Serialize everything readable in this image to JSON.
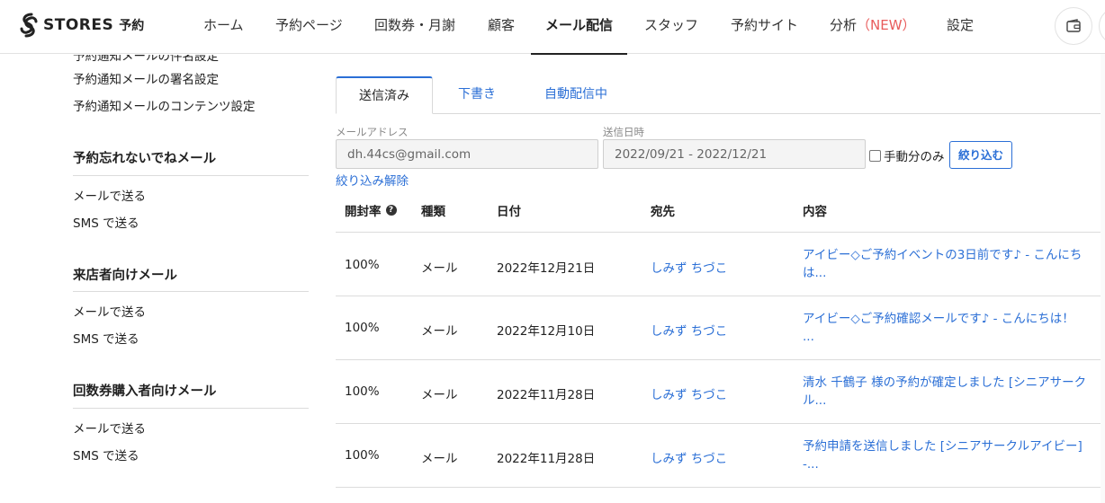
{
  "header": {
    "logo_text": "STORES",
    "logo_sub": "予約",
    "nav": [
      {
        "label": "ホーム"
      },
      {
        "label": "予約ページ"
      },
      {
        "label": "回数券・月謝"
      },
      {
        "label": "顧客"
      },
      {
        "label": "メール配信",
        "active": true
      },
      {
        "label": "スタッフ"
      },
      {
        "label": "予約サイト"
      },
      {
        "label": "分析",
        "badge": "（NEW）"
      },
      {
        "label": "設定"
      }
    ],
    "icons": [
      "wallet-icon"
    ]
  },
  "sidebar": {
    "links_top": [
      "予約通知メールの署名設定",
      "予約通知メールのコンテンツ設定"
    ],
    "sections": [
      {
        "title": "予約忘れないでねメール",
        "items": [
          "メールで送る",
          "SMS で送る"
        ]
      },
      {
        "title": "来店者向けメール",
        "items": [
          "メールで送る",
          "SMS で送る"
        ]
      },
      {
        "title": "回数券購入者向けメール",
        "items": [
          "メールで送る",
          "SMS で送る"
        ]
      }
    ]
  },
  "main": {
    "tabs": [
      {
        "label": "送信済み",
        "active": true
      },
      {
        "label": "下書き"
      },
      {
        "label": "自動配信中"
      }
    ],
    "filters": {
      "email_label": "メールアドレス",
      "email_value": "dh.44cs@gmail.com",
      "date_label": "送信日時",
      "date_value": "2022/09/21 - 2022/12/21",
      "manual_only_label": "手動分のみ",
      "manual_only_checked": false,
      "filter_button": "絞り込む",
      "clear_link": "絞り込み解除"
    },
    "table": {
      "headers": [
        "開封率",
        "種類",
        "日付",
        "宛先",
        "内容"
      ],
      "rows": [
        {
          "open_rate": "100%",
          "type": "メール",
          "date": "2022年12月21日",
          "to": "しみず ちづこ",
          "content": "アイビー◇ご予約イベントの3日前です♪ - こんにちは..."
        },
        {
          "open_rate": "100%",
          "type": "メール",
          "date": "2022年12月10日",
          "to": "しみず ちづこ",
          "content": "アイビー◇ご予約確認メールです♪ - こんにちは！ ..."
        },
        {
          "open_rate": "100%",
          "type": "メール",
          "date": "2022年11月28日",
          "to": "しみず ちづこ",
          "content": "清水 千鶴子 様の予約が確定しました [シニアサークル..."
        },
        {
          "open_rate": "100%",
          "type": "メール",
          "date": "2022年11月28日",
          "to": "しみず ちづこ",
          "content": "予約申請を送信しました [シニアサークルアイビー] -..."
        }
      ]
    }
  },
  "colors": {
    "accent": "#2b6fd6",
    "new_badge": "#e85b5b",
    "text": "#222222",
    "border": "#dcdcdc"
  }
}
